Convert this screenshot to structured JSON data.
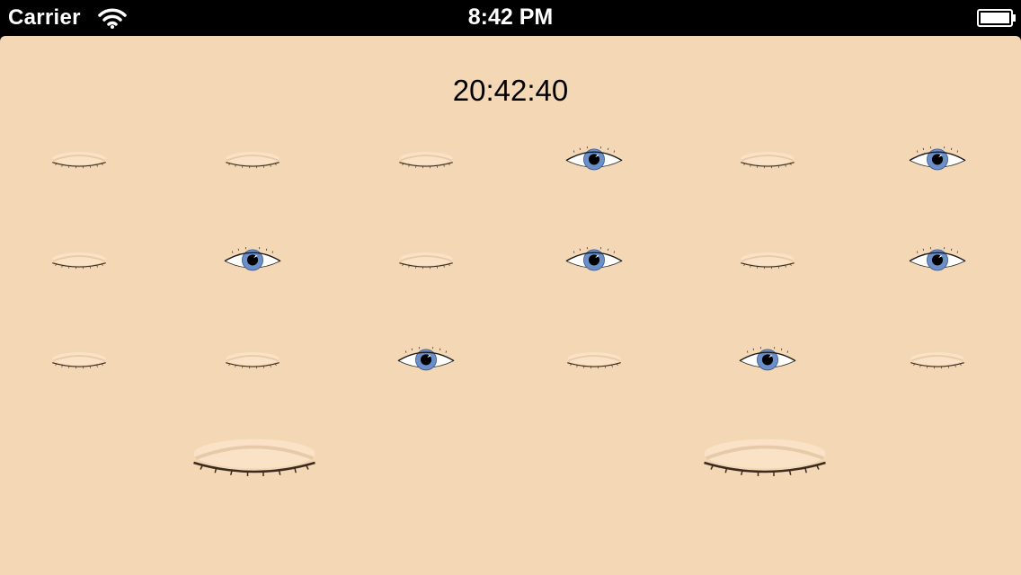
{
  "status_bar": {
    "carrier": "Carrier",
    "clock": "8:42 PM",
    "wifi_icon": "wifi-icon",
    "battery_icon": "battery-full-icon"
  },
  "app": {
    "time_display": "20:42:40",
    "colors": {
      "skin": "#f4d7b4",
      "iris": "#6a8fc9",
      "pupil": "#000000"
    },
    "grid_rows": [
      [
        "closed",
        "closed",
        "closed",
        "open",
        "closed",
        "open"
      ],
      [
        "closed",
        "open",
        "closed",
        "open",
        "closed",
        "open"
      ],
      [
        "closed",
        "closed",
        "open",
        "closed",
        "open",
        "closed"
      ]
    ],
    "bottom_eyes": [
      "closed",
      "closed"
    ]
  }
}
